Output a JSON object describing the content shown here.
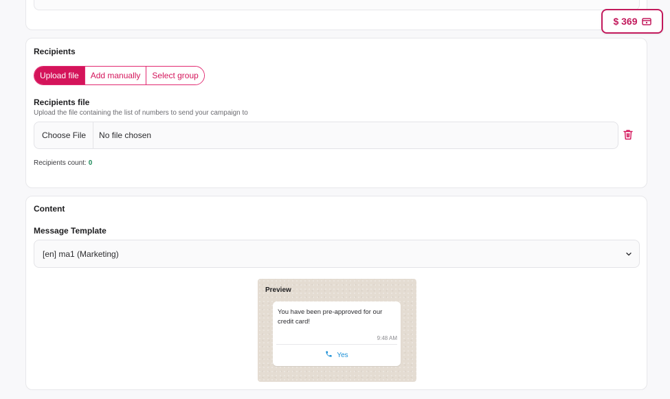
{
  "balance": {
    "amount": "$ 369",
    "icon": "wallet-icon",
    "color": "#c2185b"
  },
  "recipients": {
    "title": "Recipients",
    "tabs": [
      {
        "label": "Upload file",
        "active": true
      },
      {
        "label": "Add manually",
        "active": false
      },
      {
        "label": "Select group",
        "active": false
      }
    ],
    "file_label": "Recipients file",
    "file_helper": "Upload the file containing the list of numbers to send your campaign to",
    "choose_button": "Choose File",
    "no_file": "No file chosen",
    "delete_icon": "trash-icon",
    "count_label": "Recipients count:",
    "count_value": "0"
  },
  "content": {
    "title": "Content",
    "template_label": "Message Template",
    "template_value": "[en]  ma1  (Marketing)",
    "preview": {
      "title": "Preview",
      "message": "You have been pre-approved for our credit card!",
      "time": "9:48 AM",
      "action_label": "Yes",
      "action_icon": "phone-icon"
    }
  },
  "colors": {
    "accent": "#d4145a",
    "count_green": "#1e8b5a",
    "link_blue": "#1a8fd6"
  }
}
